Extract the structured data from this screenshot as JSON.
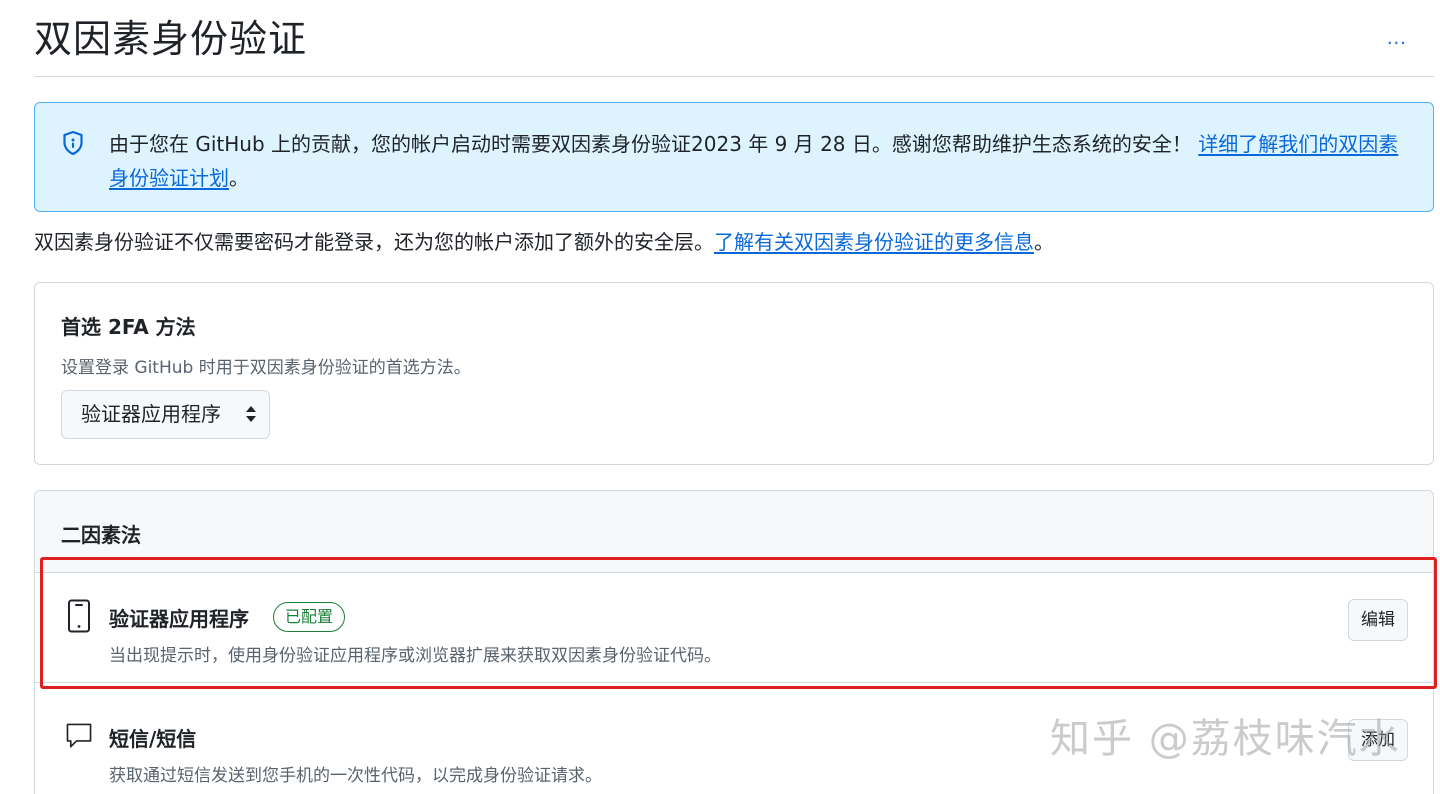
{
  "header": {
    "title": "双因素身份验证",
    "more_label": "..."
  },
  "notice": {
    "icon": "shield-icon",
    "text": "由于您在 GitHub 上的贡献，您的帐户启动时需要双因素身份验证2023 年 9 月 28 日。感谢您帮助维护生态系统的安全！",
    "link_text": "详细了解我们的双因素身份验证计划",
    "suffix": "。"
  },
  "intro": {
    "text": "双因素身份验证不仅需要密码才能登录，还为您的帐户添加了额外的安全层。",
    "link_text": "了解有关双因素身份验证的更多信息",
    "suffix": "。"
  },
  "preferred": {
    "title": "首选 2FA 方法",
    "description": "设置登录 GitHub 时用于双因素身份验证的首选方法。",
    "selected": "验证器应用程序"
  },
  "methods": {
    "title": "二因素法",
    "items": [
      {
        "icon": "mobile-device-icon",
        "title": "验证器应用程序",
        "badge": "已配置",
        "description": "当出现提示时，使用身份验证应用程序或浏览器扩展来获取双因素身份验证代码。",
        "button": "编辑"
      },
      {
        "icon": "comment-icon",
        "title": "短信/短信",
        "description": "获取通过短信发送到您手机的一次性代码，以完成身份验证请求。",
        "button": "添加"
      }
    ]
  },
  "watermark": "知乎 @荔枝味汽水",
  "colors": {
    "accent": "#0969da",
    "notice_bg": "#ddf4ff",
    "notice_border": "#54aeff",
    "success": "#1a7f37",
    "highlight": "#e02020"
  }
}
